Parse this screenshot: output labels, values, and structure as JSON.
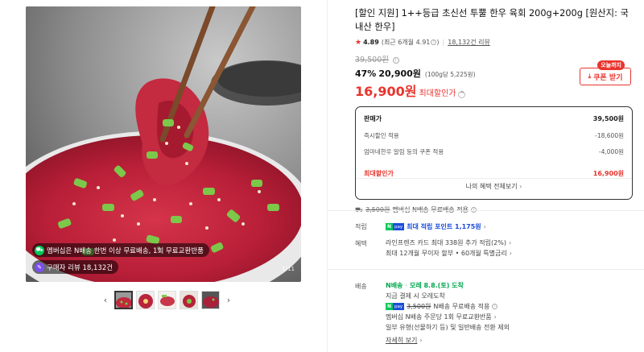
{
  "gallery": {
    "badge_shipping": "멤버십은 N배송 한번 이상 무료배송, 1회 무료교환반품",
    "badge_reviews": "구매자 리뷰 18,132건",
    "counter": "1/11",
    "prev_icon": "chevron-left-icon",
    "next_icon": "chevron-right-icon"
  },
  "product": {
    "title": "[할인 지원] 1++등급 초신선 투뿔 한우 육회 200g+200g [원산지: 국내산 한우]",
    "rating": "4.89",
    "rating_detail": "(최근 6개월 4.91",
    "rating_detail_close": ")",
    "review_count": "18,132건 리뷰"
  },
  "price": {
    "original": "39,500원",
    "discount_pct": "47%",
    "sale_price": "20,900원",
    "unit_price": "(100g당 5,225원)",
    "max_discount_price": "16,900원",
    "max_discount_label": "최대할인가",
    "today_tag": "오늘까지",
    "coupon_label": "쿠폰 받기"
  },
  "breakdown": {
    "rows": [
      {
        "label": "판매가",
        "value": "39,500원"
      },
      {
        "label": "즉시할인 적용",
        "value": "-18,600원"
      },
      {
        "label": "엄마네한우 알림 등의 쿠폰 적용",
        "value": "-4,000원"
      }
    ],
    "max_label": "최대할인가",
    "max_value": "16,900원",
    "benefits_link": "나의 혜택 전체보기"
  },
  "shipping_free": {
    "strike": "3,500원",
    "text": "멤버십 N배송 무료배송 적용"
  },
  "points": {
    "label": "적립",
    "text": "최대 적립 포인트 1,175원"
  },
  "benefits": {
    "label": "혜택",
    "line1": "라인프렌즈 카드 최대 338원 추가 적립(2%)",
    "line2": "최대 12개월 무이자 할부 • 60개월 특별금리"
  },
  "delivery": {
    "label": "배송",
    "arrival": "모레 8.8.(토) 도착",
    "pay_now": "지금 결제 시 오레도착",
    "free_strike": "3,500원",
    "free_text": "N배송 무료배송 적용",
    "return_text": "멤버십 N배송 주문당 1회 무료교환반품",
    "exclude_text": "일부 유형(선물하기 등) 및 일반배송 전환 제외",
    "more_link": "자세히 보기"
  },
  "colors": {
    "accent_red": "#e8342d",
    "npay_green": "#03c75a",
    "npay_blue": "#1a4ddb"
  }
}
